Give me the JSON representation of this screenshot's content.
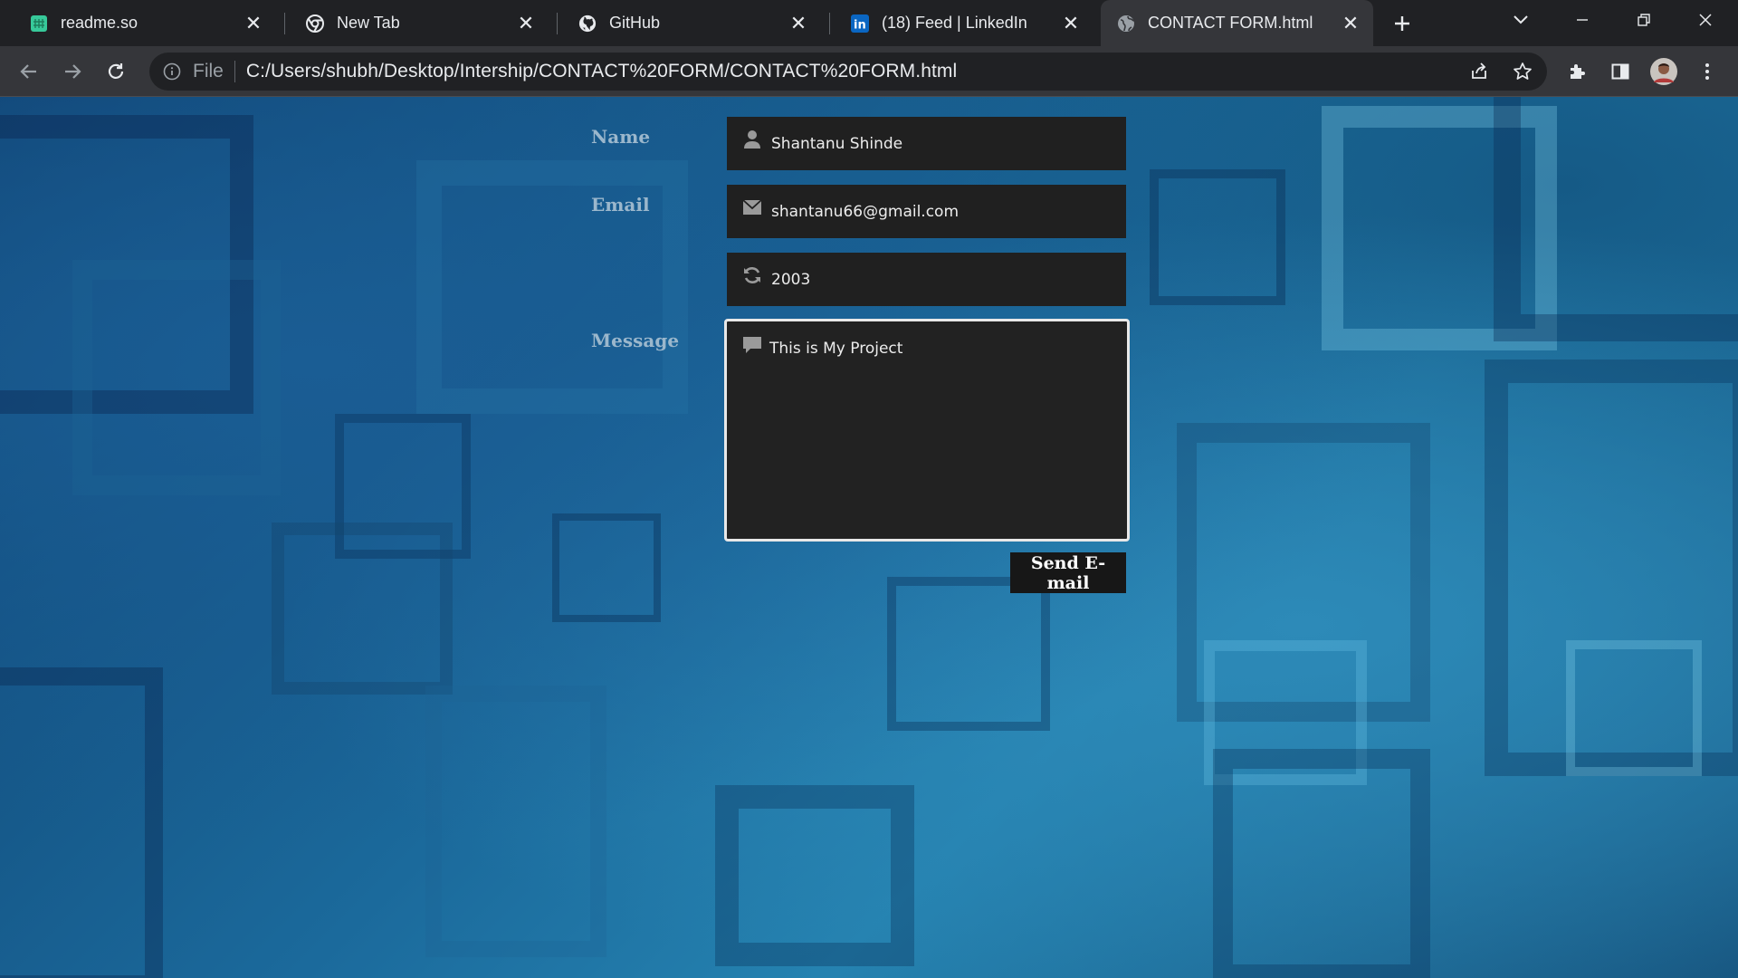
{
  "browser": {
    "tabs": [
      {
        "title": "readme.so",
        "icon": "readme-so-icon"
      },
      {
        "title": "New Tab",
        "icon": "chrome-icon"
      },
      {
        "title": "GitHub",
        "icon": "github-icon"
      },
      {
        "title": "(18) Feed | LinkedIn",
        "icon": "linkedin-icon"
      },
      {
        "title": "CONTACT FORM.html",
        "icon": "globe-icon",
        "active": true
      }
    ],
    "address": {
      "scheme_label": "File",
      "url": "C:/Users/shubh/Desktop/Intership/CONTACT%20FORM/CONTACT%20FORM.html"
    }
  },
  "form": {
    "name_label": "Name",
    "name_value": "Shantanu Shinde",
    "email_label": "Email",
    "email_value": "shantanu66@gmail.com",
    "extra_value": "2003",
    "message_label": "Message",
    "message_value": "This is My Project",
    "send_label": "Send E-mail"
  },
  "colors": {
    "tab_strip": "#202124",
    "toolbar": "#35363a",
    "field_bg": "#202020",
    "label_text": "#9bb7cc",
    "button_bg": "#171717"
  }
}
